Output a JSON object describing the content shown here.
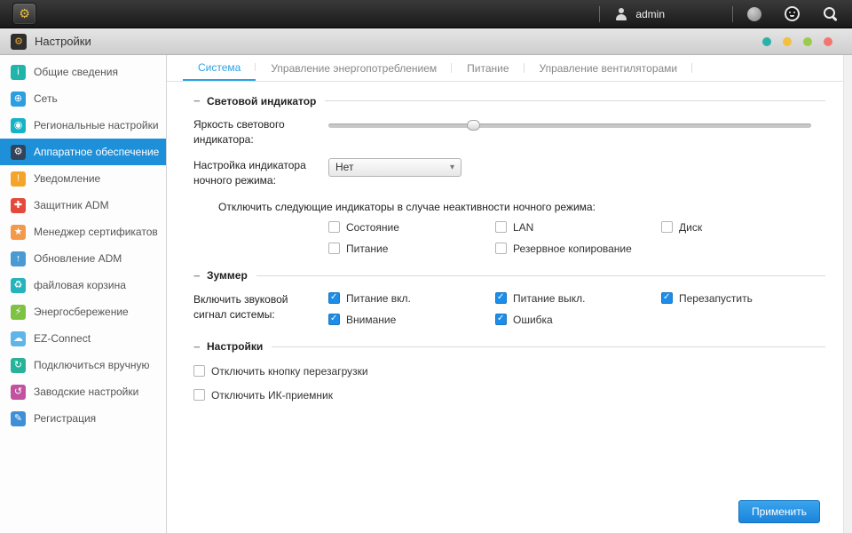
{
  "topbar": {
    "user": "admin"
  },
  "window": {
    "title": "Настройки",
    "dot_colors": [
      "#2cb1a6",
      "#f2c03e",
      "#9bcb4b",
      "#f3756e"
    ]
  },
  "icons": {
    "gear": "⚙",
    "collapse": "−",
    "chevron_down": "▾",
    "check": "✓"
  },
  "sidebar": {
    "items": [
      {
        "label": "Общие сведения",
        "icon": "info-icon",
        "glyph": "i"
      },
      {
        "label": "Сеть",
        "icon": "globe-icon",
        "glyph": "⊕"
      },
      {
        "label": "Региональные настройки",
        "icon": "region-icon",
        "glyph": "◉"
      },
      {
        "label": "Аппаратное обеспечение",
        "icon": "hardware-icon",
        "glyph": "⚙",
        "active": true
      },
      {
        "label": "Уведомление",
        "icon": "notification-icon",
        "glyph": "!"
      },
      {
        "label": "Защитник ADM",
        "icon": "shield-icon",
        "glyph": "✚"
      },
      {
        "label": "Менеджер сертификатов",
        "icon": "certificate-icon",
        "glyph": "★"
      },
      {
        "label": "Обновление ADM",
        "icon": "update-icon",
        "glyph": "↑"
      },
      {
        "label": "файловая корзина",
        "icon": "recycle-bin-icon",
        "glyph": "♻"
      },
      {
        "label": "Энергосбережение",
        "icon": "energy-icon",
        "glyph": "⚡"
      },
      {
        "label": "EZ-Connect",
        "icon": "cloud-icon",
        "glyph": "☁"
      },
      {
        "label": "Подключиться вручную",
        "icon": "manual-connect-icon",
        "glyph": "↻"
      },
      {
        "label": "Заводские настройки",
        "icon": "factory-reset-icon",
        "glyph": "↺"
      },
      {
        "label": "Регистрация",
        "icon": "registration-icon",
        "glyph": "✎"
      }
    ]
  },
  "tabs": [
    {
      "label": "Система",
      "active": true
    },
    {
      "label": "Управление энергопотреблением"
    },
    {
      "label": "Питание"
    },
    {
      "label": "Управление вентиляторами"
    }
  ],
  "led": {
    "title": "Световой индикатор",
    "brightness_label": "Яркость светового индикатора:",
    "brightness_percent": 30,
    "night_label": "Настройка индикатора ночного режима:",
    "night_value": "Нет",
    "night_disable_label": "Отключить следующие индикаторы в случае неактивности ночного режима:",
    "indicators": [
      {
        "label": "Состояние",
        "checked": false
      },
      {
        "label": "LAN",
        "checked": false
      },
      {
        "label": "Диск",
        "checked": false
      },
      {
        "label": "Питание",
        "checked": false
      },
      {
        "label": "Резервное копирование",
        "checked": false
      }
    ]
  },
  "buzzer": {
    "title": "Зуммер",
    "label": "Включить звуковой сигнал системы:",
    "options": [
      {
        "label": "Питание вкл.",
        "checked": true
      },
      {
        "label": "Питание выкл.",
        "checked": true
      },
      {
        "label": "Перезапустить",
        "checked": true
      },
      {
        "label": "Внимание",
        "checked": true
      },
      {
        "label": "Ошибка",
        "checked": true
      }
    ]
  },
  "settings": {
    "title": "Настройки",
    "options": [
      {
        "label": "Отключить кнопку перезагрузки",
        "checked": false
      },
      {
        "label": "Отключить ИК-приемник",
        "checked": false
      }
    ]
  },
  "footer": {
    "apply_label": "Применить"
  },
  "colors": {
    "accent": "#2ba3e3",
    "sidebar_selected": "#1e90da",
    "checkbox_checked": "#1d8de8",
    "button": "#1b84dc"
  }
}
